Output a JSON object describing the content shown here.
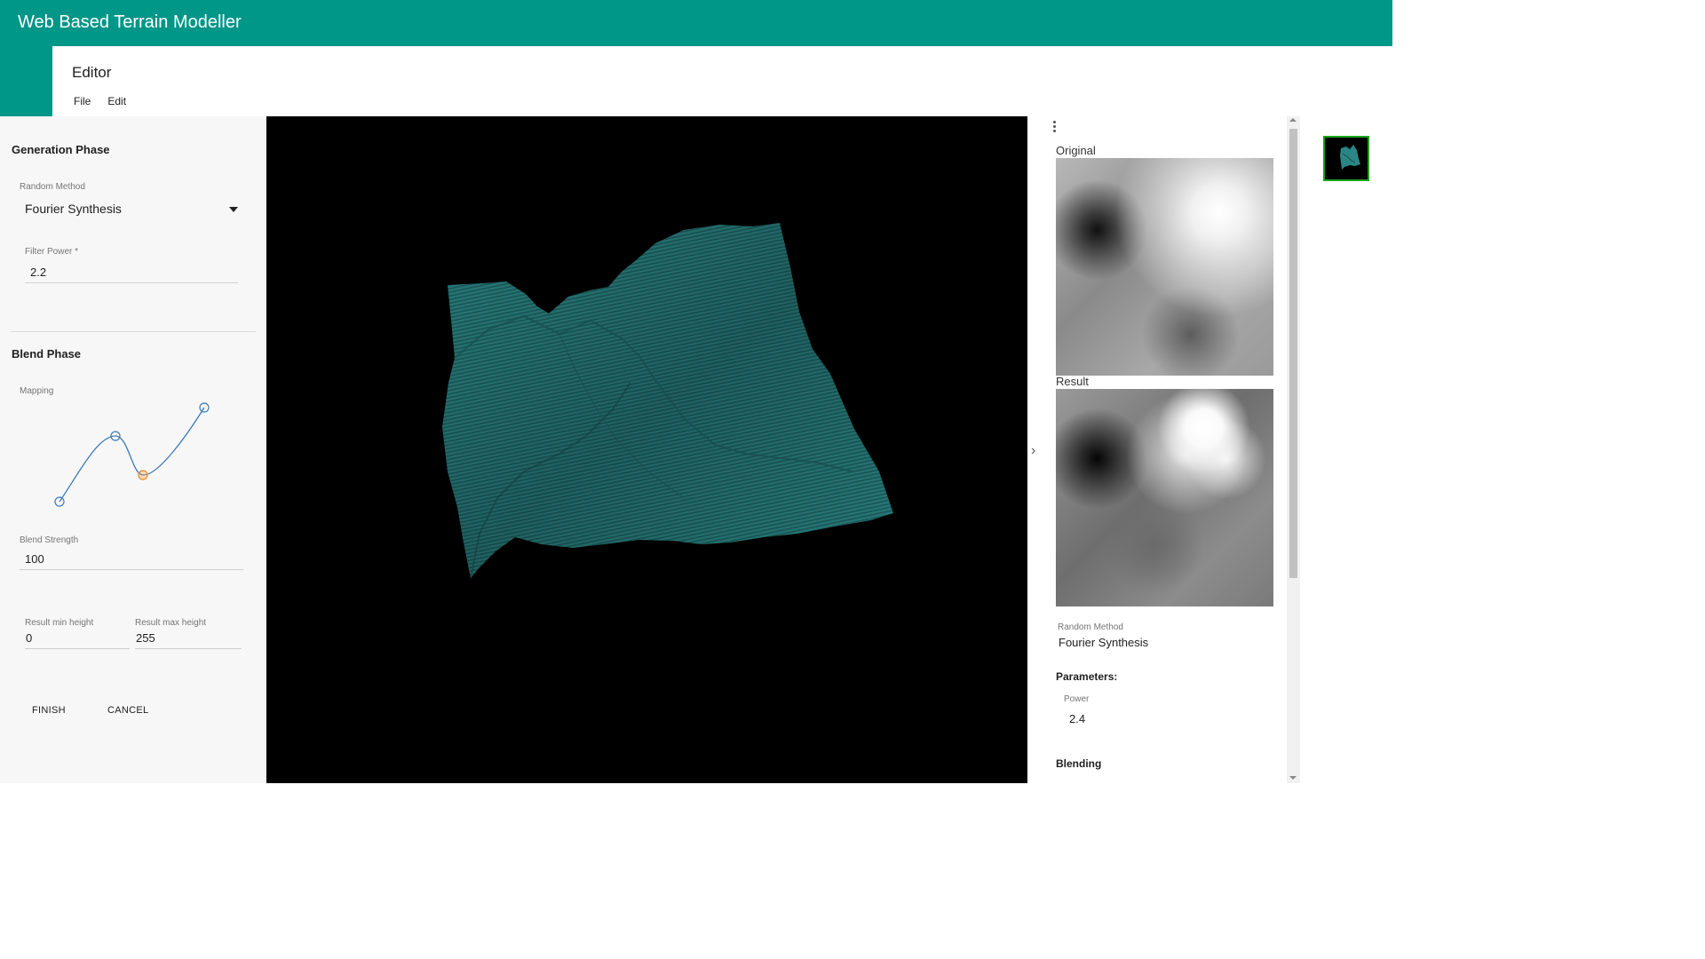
{
  "app": {
    "title": "Web Based Terrain Modeller",
    "accent_color": "#009688",
    "terrain_color": "#2b8585"
  },
  "editor": {
    "title": "Editor",
    "menu": [
      "File",
      "Edit"
    ]
  },
  "left_panel": {
    "generation": {
      "title": "Generation Phase",
      "random_method_label": "Random Method",
      "random_method_value": "Fourier Synthesis",
      "filter_power_label": "Filter Power",
      "filter_power_required": "*",
      "filter_power_value": "2.2"
    },
    "blend": {
      "title": "Blend Phase",
      "mapping_label": "Mapping",
      "blend_strength_label": "Blend Strength",
      "blend_strength_value": "100",
      "min_height_label": "Result min height",
      "min_height_value": "0",
      "max_height_label": "Result max height",
      "max_height_value": "255"
    },
    "buttons": {
      "finish": "FINISH",
      "cancel": "CANCEL"
    }
  },
  "right_panel": {
    "original_label": "Original",
    "result_label": "Result",
    "random_method_label": "Random Method",
    "random_method_value": "Fourier Synthesis",
    "parameters_heading": "Parameters:",
    "power_label": "Power",
    "power_value": "2.4",
    "blending_heading": "Blending"
  },
  "icons": {
    "kebab": "more-vert-icon",
    "chevron": "chevron-right-icon",
    "dropdown": "arrow-drop-down-icon"
  }
}
